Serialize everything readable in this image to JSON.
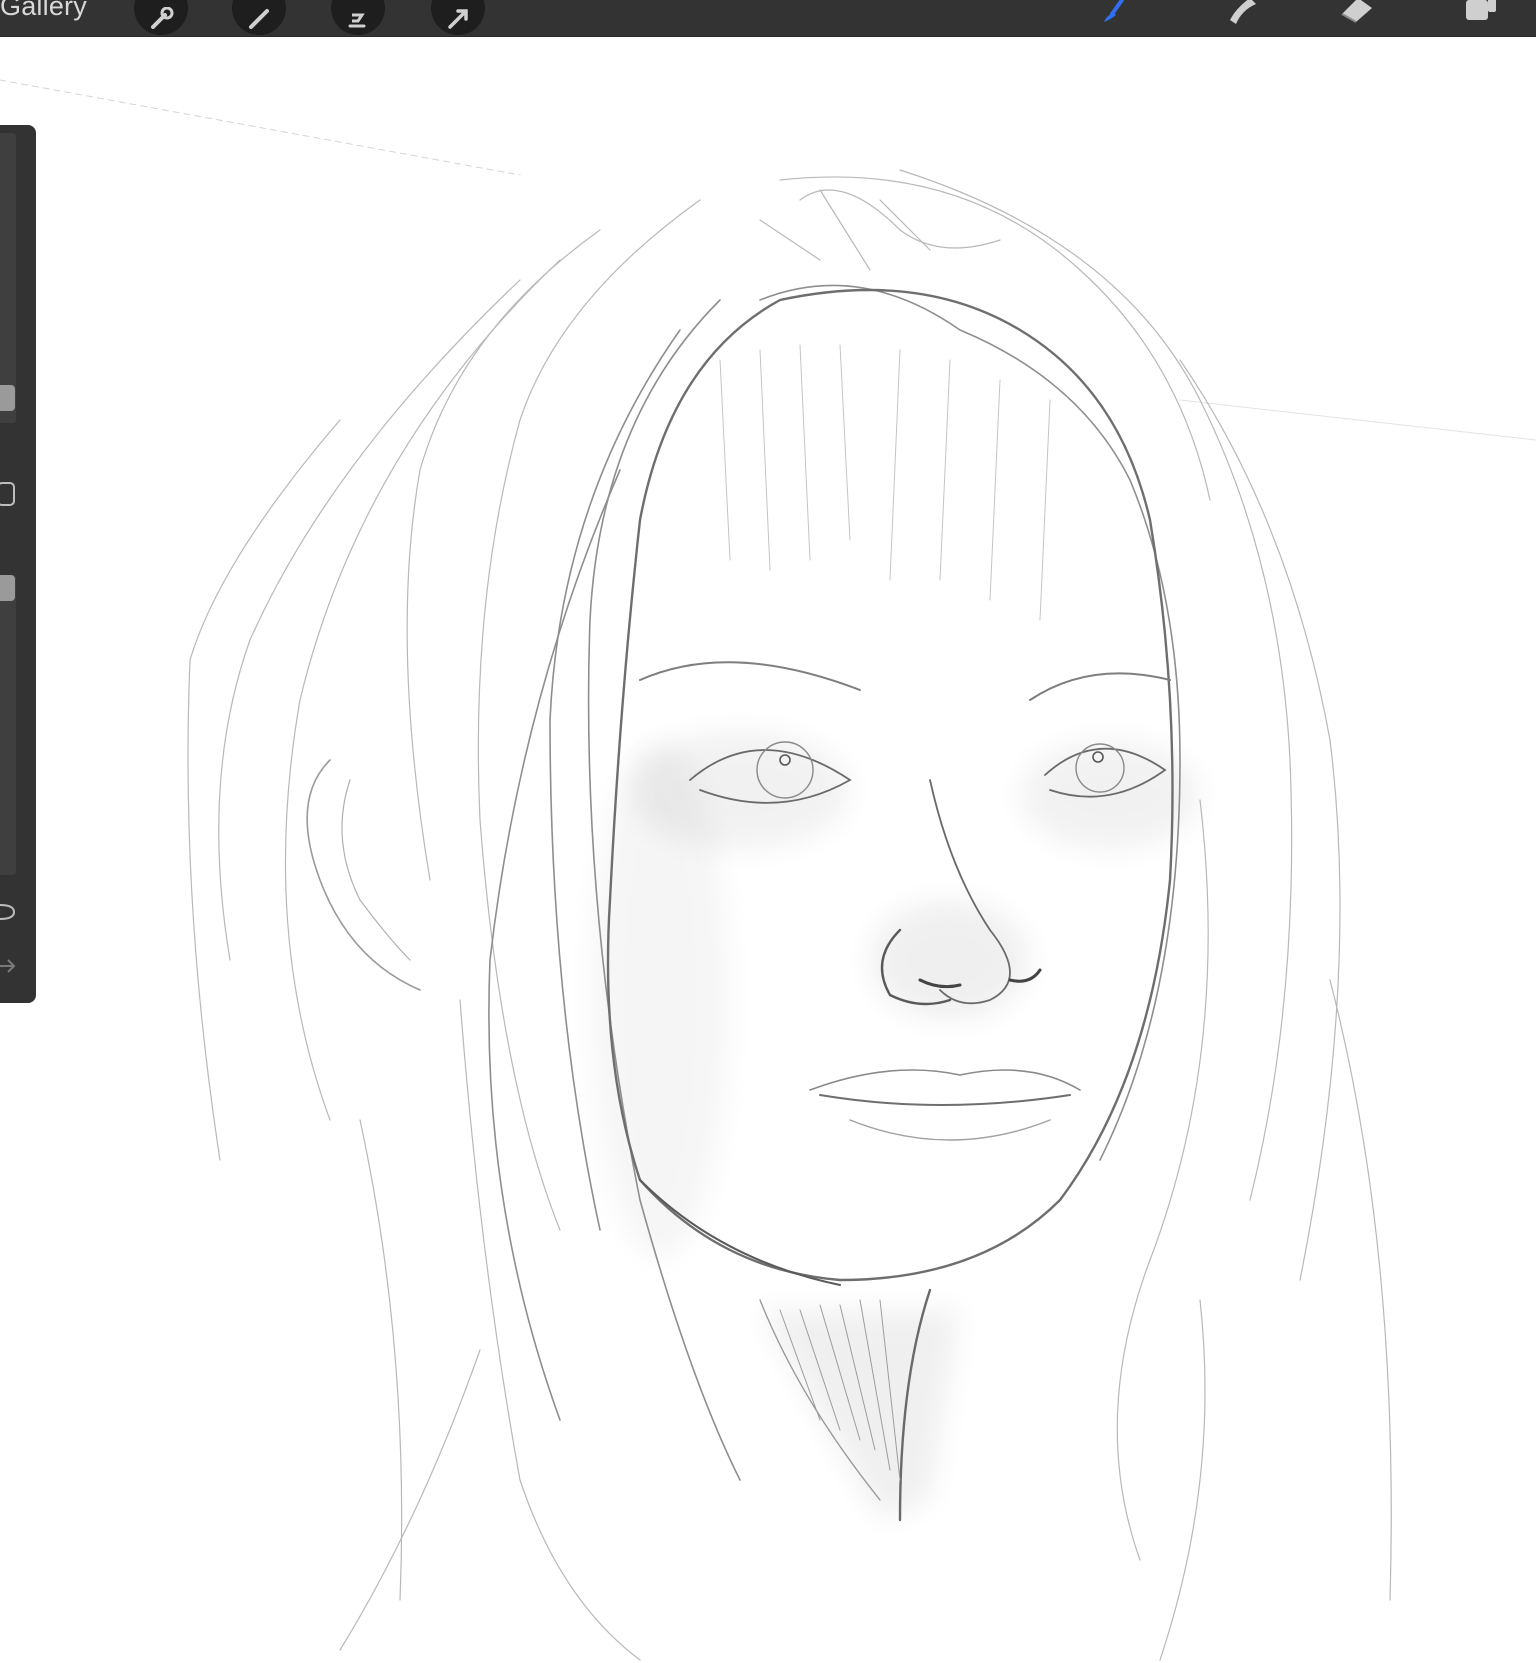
{
  "topbar": {
    "gallery_label": "Gallery",
    "left_buttons": [
      "wrench-icon",
      "magic-wand-icon",
      "selection-icon",
      "transform-arrow-icon"
    ],
    "right_tools": [
      "brush-icon",
      "smudge-icon",
      "eraser-icon",
      "layers-icon"
    ],
    "active_tool": "brush-icon",
    "active_color": "#2f6ff0"
  },
  "sidebar": {
    "controls": [
      "brush-size-slider",
      "modify-button",
      "opacity-slider",
      "undo-button",
      "redo-button"
    ]
  },
  "canvas": {
    "content": "pencil-sketch-portrait"
  }
}
